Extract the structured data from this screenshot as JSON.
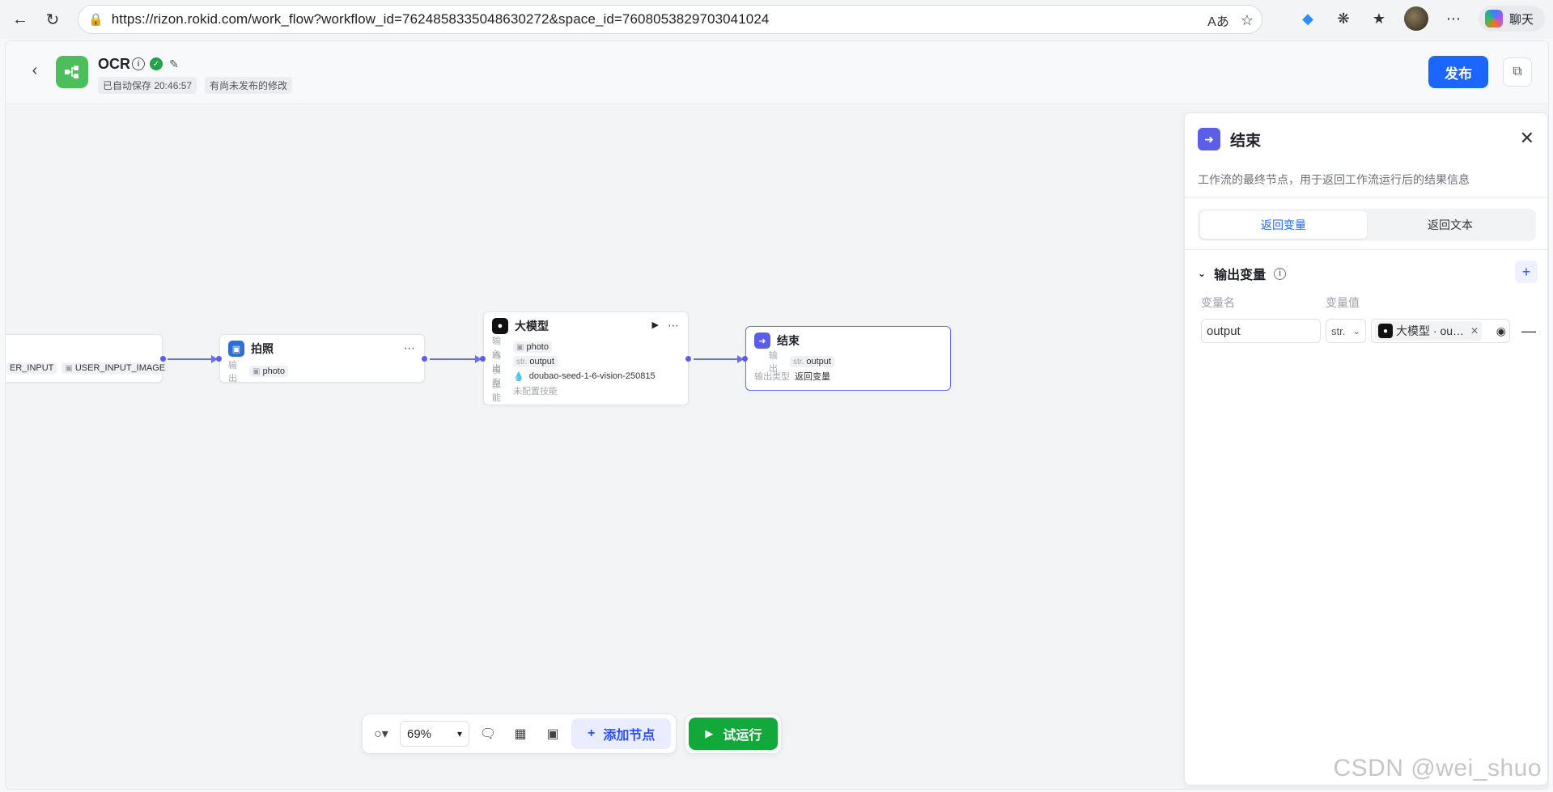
{
  "browser": {
    "url": "https://rizon.rokid.com/work_flow?workflow_id=7624858335048630272&space_id=7608053829703041024",
    "chat_label": "聊天"
  },
  "header": {
    "title": "OCR",
    "autosave": "已自动保存 20:46:57",
    "unpublished": "有尚未发布的修改",
    "publish_label": "发布"
  },
  "nodes": {
    "start": {
      "out1": "ER_INPUT",
      "out2": "USER_INPUT_IMAGE"
    },
    "photo": {
      "title": "拍照",
      "out_label": "输出",
      "out_value": "photo"
    },
    "llm": {
      "title": "大模型",
      "in_label": "输入",
      "in_value": "photo",
      "out_label": "输出",
      "out_type": "str.",
      "out_value": "output",
      "model_label": "模型",
      "model_value": "doubao-seed-1-6-vision-250815",
      "skill_label": "技能",
      "skill_value": "未配置技能"
    },
    "end": {
      "title": "结束",
      "out_label": "输出",
      "out_type": "str.",
      "out_value": "output",
      "out_kind_label": "输出类型",
      "out_kind_value": "返回变量"
    }
  },
  "toolbar": {
    "zoom": "69%",
    "add_node": "添加节点",
    "run": "试运行"
  },
  "panel": {
    "title": "结束",
    "description": "工作流的最终节点，用于返回工作流运行后的结果信息",
    "tabs": [
      "返回变量",
      "返回文本"
    ],
    "section": "输出变量",
    "col_name": "变量名",
    "col_value": "变量值",
    "var_name": "output",
    "var_type": "str.",
    "ref_label": "大模型 · output"
  },
  "watermark": "CSDN @wei_shuo",
  "colors": {
    "primary": "#1a66ff",
    "run": "#13a83a",
    "edge": "#6a6ff0",
    "logo": "#4cbf5c"
  }
}
